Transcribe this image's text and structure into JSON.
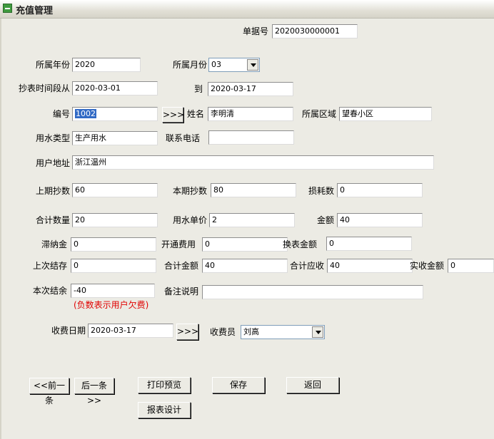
{
  "window": {
    "title": "充值管理"
  },
  "form": {
    "bill_no_label": "单据号",
    "bill_no": "2020030000001",
    "year_label": "所属年份",
    "year": "2020",
    "month_label": "所属月份",
    "month": "03",
    "period_from_label": "抄表时间段从",
    "period_from": "2020-03-01",
    "period_to_label": "到",
    "period_to": "2020-03-17",
    "number_label": "编号",
    "number": "1002",
    "pick_button": ">>>",
    "name_label": "姓名",
    "name": "李明清",
    "area_label": "所属区域",
    "area": "望春小区",
    "water_type_label": "用水类型",
    "water_type": "生产用水",
    "phone_label": "联系电话",
    "phone": "",
    "address_label": "用户地址",
    "address": "浙江温州",
    "prev_reading_label": "上期抄数",
    "prev_reading": "60",
    "curr_reading_label": "本期抄数",
    "curr_reading": "80",
    "loss_label": "损耗数",
    "loss": "0",
    "total_qty_label": "合计数量",
    "total_qty": "20",
    "unit_price_label": "用水单价",
    "unit_price": "2",
    "amount_label": "金额",
    "amount": "40",
    "late_fee_label": "滞纳金",
    "late_fee": "0",
    "open_fee_label": "开通费用",
    "open_fee": "0",
    "meter_change_label": "换表金额",
    "meter_change": "0",
    "last_balance_label": "上次结存",
    "last_balance": "0",
    "total_amount_label": "合计金额",
    "total_amount": "40",
    "total_due_label": "合计应收",
    "total_due": "40",
    "received_label": "实收金额",
    "received": "0",
    "current_balance_label": "本次结余",
    "current_balance": "-40",
    "negative_hint": "(负数表示用户欠费)",
    "remark_label": "备注说明",
    "remark": "",
    "charge_date_label": "收费日期",
    "charge_date": "2020-03-17",
    "date_pick_button": ">>>",
    "cashier_label": "收费员",
    "cashier": "刘高"
  },
  "buttons": {
    "prev": "<<前一条",
    "next": "后一条>>",
    "print_preview": "打印预览",
    "save": "保存",
    "back": "返回",
    "report_design": "报表设计"
  }
}
